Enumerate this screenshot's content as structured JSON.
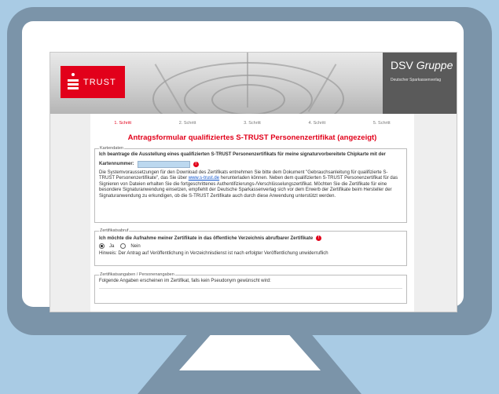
{
  "brand": {
    "logo_text": "TRUST",
    "group_name": "DSV",
    "group_name_italic": "Gruppe",
    "group_sub": "Deutscher Sparkassenverlag",
    "accent": "#e2001a"
  },
  "steps": [
    "1. Schritt",
    "2. Schritt",
    "3. Schritt",
    "4. Schritt",
    "5. Schritt"
  ],
  "form_title": "Antragsformular qualifiziertes S-TRUST Personenzertifikat (angezeigt)",
  "kartendaten": {
    "legend": "Kartendaten",
    "intro": "Ich beantrage die Ausstellung eines qualifizierten S-TRUST Personenzertifikats für meine signaturvorbereitete Chipkarte mit der",
    "card_label": "Kartennummer:",
    "card_value": "",
    "info_1": "Die Systemvoraussetzungen für den Download des Zertifikats entnehmen Sie bitte dem Dokument \"Gebrauchsanleitung für qualifizierte S-TRUST Personenzertifikate\", das Sie über",
    "info_link": "www.s-trust.de",
    "info_2": "herunterladen können. Neben dem qualifizierten S-TRUST Personenzertifikat für das Signieren von Dateien erhalten Sie die fortgeschrittenes Authentifizierungs-/Verschlüsselungszertifikat. Möchten Sie die Zertifikate für eine besondere Signaturanwendung einsetzen, empfiehlt der Deutsche Sparkassenverlag sich vor dem Erwerb der Zertifikate beim Hersteller der Signaturanwendung zu erkundigen, ob die S-TRUST Zertifikate auch durch diese Anwendung unterstützt werden."
  },
  "zertifikatsabruf": {
    "legend": "Zertifikatsabruf",
    "question": "Ich möchte die Aufnahme meiner Zertifikate in das öffentliche Verzeichnis abrufbarer Zertifikate",
    "yes": "Ja",
    "no": "Nein",
    "hint": "Hinweis: Der Antrag auf Veröffentlichung in Verzeichnisdienst ist nach erfolgter Veröffentlichung unwiderruflich"
  },
  "zertifikatsangaben": {
    "legend": "Zertifikatsangaben / Personenangaben",
    "text": "Folgende Angaben erscheinen im Zertifikat, falls kein Pseudonym gewünscht wird:"
  }
}
